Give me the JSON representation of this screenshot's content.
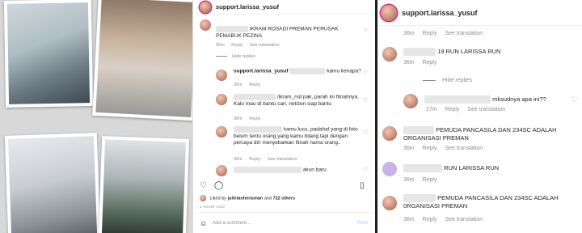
{
  "middle": {
    "username": "support.larissa_yusuf",
    "comments": [
      {
        "text": "IKRAM ROSADI PREMAN PERUSAK PEMABUK PEZINA",
        "time": "36m",
        "reply": "Reply",
        "see_translation": "See translation"
      },
      {
        "hide_replies": "Hide replies"
      },
      {
        "user": "support.larissa_yusuf",
        "text": "kamu kenapa?",
        "time": "30m",
        "reply": "Reply"
      },
      {
        "text": "/ikram_rsd pak, parah ini fitnahnya. Kalo mau di bantu cari, netizen siap bantu",
        "time": "30m",
        "reply": "Reply"
      },
      {
        "text": "kamu lucu, padahal yang di foto belum tentu orang yang kamu bilang tapi dengan percaya diri menyebarkan fitnah nama orang..",
        "time": "30m",
        "reply": "Reply",
        "see_translation": "See translation"
      },
      {
        "text": "akun baru",
        "time": "",
        "reply": ""
      }
    ],
    "liked_by": "Liked by",
    "liked_user": "julietanherisman",
    "liked_and": "and",
    "liked_others": "722 others",
    "posted_ago": "1 HOUR AGO",
    "add_comment": "Add a comment...",
    "post": "Post",
    "emoji_icon": "smile-icon"
  },
  "right": {
    "username": "support.larissa_yusuf",
    "comments": [
      {
        "time": "36m",
        "reply": "Reply",
        "see_translation": "See translation"
      },
      {
        "text": "19 RUN LARISSA RUN",
        "time": "36m",
        "reply": "Reply"
      },
      {
        "hide_replies": "Hide replies"
      },
      {
        "text": "mksudnya apa ini??",
        "time": "27m",
        "reply": "Reply",
        "see_translation": "See translation"
      },
      {
        "text": "PEMUDA PANCASILA DAN 234SC ADALAH ORGANISASI PREMAN",
        "time": "36m",
        "reply": "Reply",
        "see_translation": "See translation"
      },
      {
        "text": "RUN LARISSA RUN",
        "time": "36m",
        "reply": "Reply"
      },
      {
        "text": "PEMUDA PANCASILA DAN 234SC ADALAH 0RGANISASI PREMAN",
        "time": "36m",
        "reply": "Reply",
        "see_translation": "See translation"
      }
    ]
  },
  "colors": {
    "story_ring": "#d62976",
    "muted_text": "#8e8e8e",
    "divider": "#1f1f1f"
  }
}
